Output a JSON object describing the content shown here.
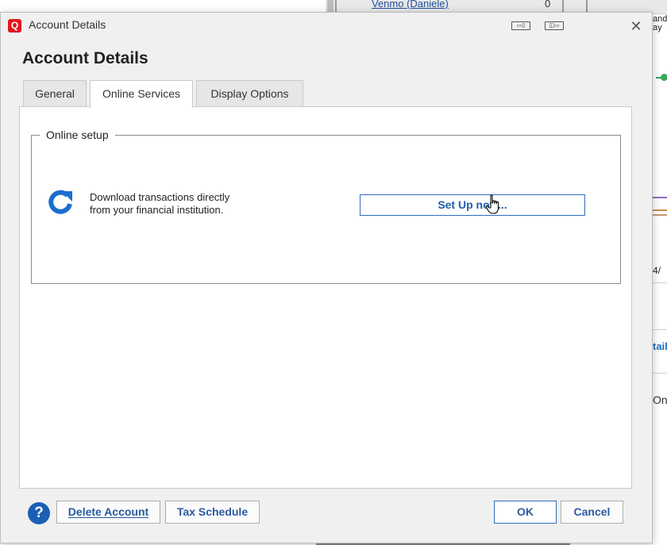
{
  "background": {
    "account_name": "Venmo (Daniele)",
    "account_value": "0",
    "side_text_1": "and",
    "side_text_2": "ay",
    "side_text_3": "4/",
    "side_text_4": "tail",
    "side_text_5": "On"
  },
  "window": {
    "title": "Account Details",
    "close_glyph": "✕"
  },
  "page": {
    "title": "Account Details"
  },
  "tabs": [
    {
      "label": "General",
      "active": false
    },
    {
      "label": "Online Services",
      "active": true
    },
    {
      "label": "Display Options",
      "active": false
    }
  ],
  "online_setup": {
    "group_title": "Online setup",
    "description": "Download transactions directly from your financial institution.",
    "setup_button": "Set Up now..."
  },
  "footer": {
    "help_glyph": "?",
    "delete_account": "Delete Account",
    "tax_schedule": "Tax Schedule",
    "ok": "OK",
    "cancel": "Cancel"
  },
  "colors": {
    "accent_blue": "#1f5fae",
    "logo_red": "#e2141e"
  },
  "icons": {
    "app": "quicken-logo-icon",
    "sync": "refresh-icon",
    "help": "help-icon",
    "cursor": "hand-pointer-icon"
  }
}
